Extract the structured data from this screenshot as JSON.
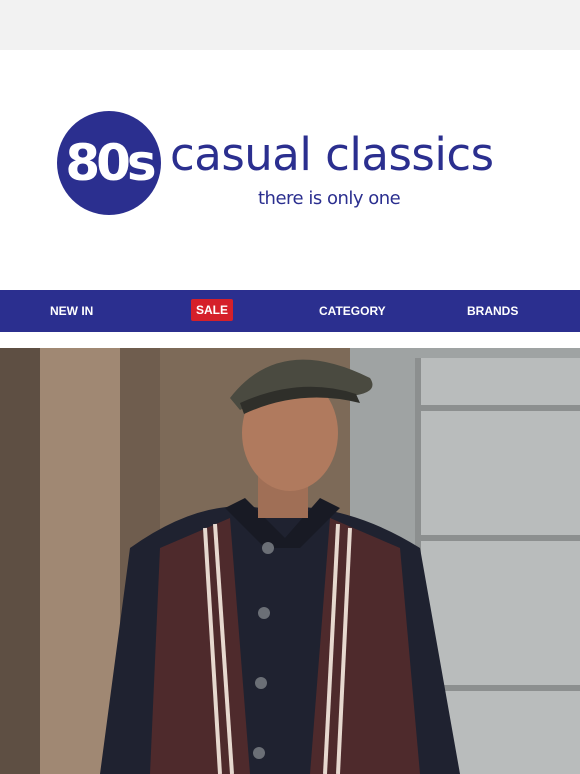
{
  "logo": {
    "badge": "80s",
    "name": "casual classics",
    "tagline": "there is only one"
  },
  "nav": {
    "items": [
      "NEW IN",
      "SALE",
      "CATEGORY",
      "BRANDS"
    ]
  },
  "colors": {
    "brand": "#2b2f8f",
    "sale": "#d5202a",
    "topbar": "#f2f2f2"
  }
}
